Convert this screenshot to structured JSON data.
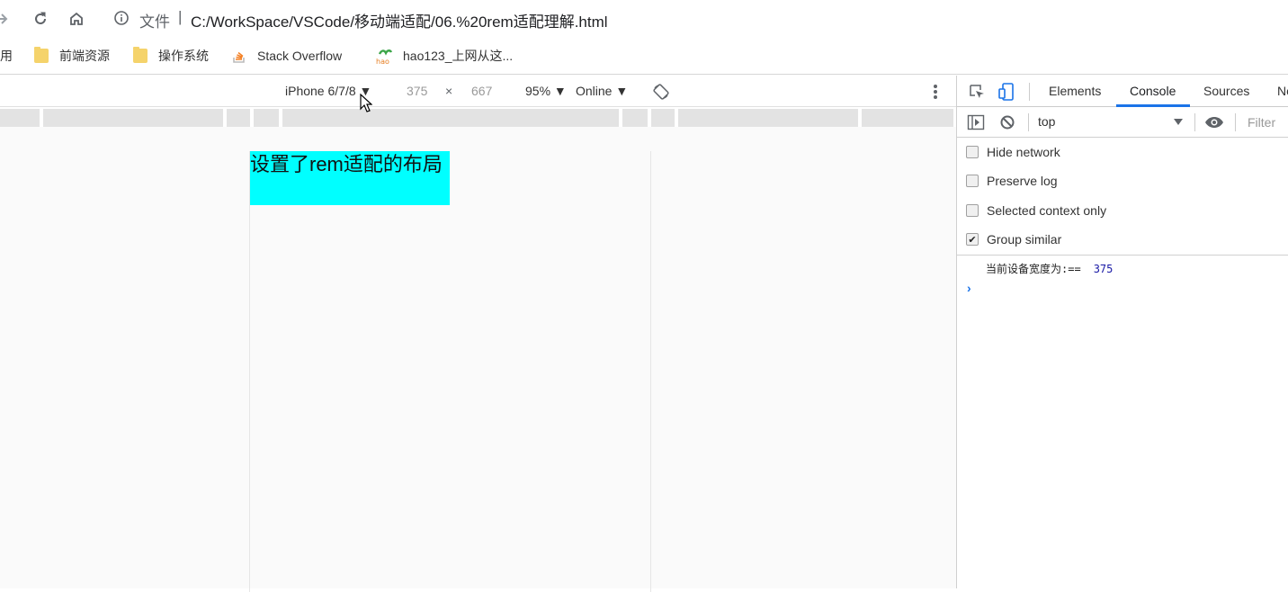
{
  "address_bar": {
    "security_label": "文件",
    "separator": "|",
    "url": "C:/WorkSpace/VSCode/移动端适配/06.%20rem适配理解.html"
  },
  "bookmarks": [
    {
      "label": "用",
      "icon": "none"
    },
    {
      "label": "前端资源",
      "icon": "folder-icon"
    },
    {
      "label": "操作系统",
      "icon": "folder-icon"
    },
    {
      "label": "Stack Overflow",
      "icon": "stackoverflow-icon"
    },
    {
      "label": "hao123_上网从这...",
      "icon": "hao123-icon"
    }
  ],
  "device_toolbar": {
    "device": "iPhone 6/7/8 ▼",
    "width": "375",
    "times": "×",
    "height": "667",
    "zoom": "95% ▼",
    "throttle": "Online ▼"
  },
  "page": {
    "box_text": "设置了rem适配的布局",
    "box_color": "#00ffff"
  },
  "devtools": {
    "tabs": [
      "Elements",
      "Console",
      "Sources",
      "Ne"
    ],
    "active_tab": "Console",
    "context": "top",
    "filter_placeholder": "Filter",
    "options": [
      {
        "label": "Hide network",
        "checked": false
      },
      {
        "label": "Preserve log",
        "checked": false
      },
      {
        "label": "Selected context only",
        "checked": false
      },
      {
        "label": "Group similar",
        "checked": true
      }
    ],
    "log": {
      "message": "当前设备宽度为:==",
      "value": "375"
    },
    "prompt": "›"
  },
  "accent_color": "#1a73e8"
}
